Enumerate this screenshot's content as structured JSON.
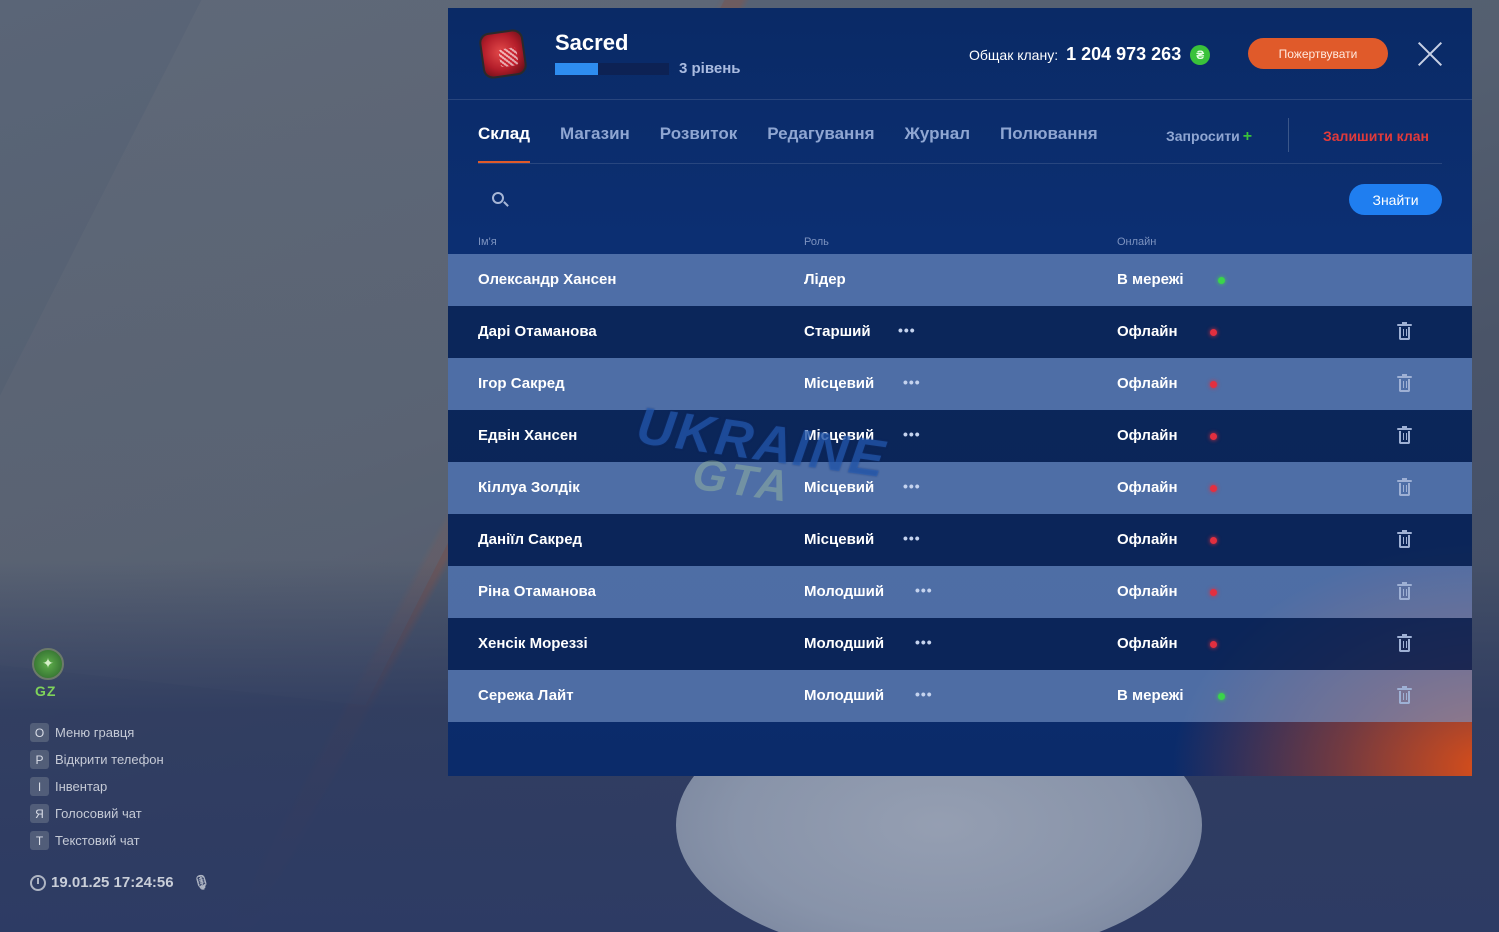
{
  "hud": {
    "badge_label": "GZ",
    "shortcuts": [
      {
        "key": "O",
        "label": "Меню гравця"
      },
      {
        "key": "P",
        "label": "Відкрити телефон"
      },
      {
        "key": "I",
        "label": "Інвентар"
      },
      {
        "key": "Я",
        "label": "Голосовий чат"
      },
      {
        "key": "T",
        "label": "Текстовий чат"
      }
    ],
    "datetime": "19.01.25 17:24:56"
  },
  "clan": {
    "name": "Sacred",
    "level_label": "3 рівень",
    "level_progress": 0.38,
    "treasury_label": "Общак клану:",
    "treasury_value": "1 204 973 263",
    "currency_symbol": "₴",
    "donate_label": "Пожертвувати"
  },
  "tabs": [
    {
      "label": "Склад",
      "active": true
    },
    {
      "label": "Магазин",
      "active": false
    },
    {
      "label": "Розвиток",
      "active": false
    },
    {
      "label": "Редагування",
      "active": false
    },
    {
      "label": "Журнал",
      "active": false
    },
    {
      "label": "Полювання",
      "active": false
    }
  ],
  "actions": {
    "invite_label": "Запросити",
    "leave_label": "Залишити клан"
  },
  "search": {
    "placeholder": "",
    "button_label": "Знайти"
  },
  "columns": {
    "name": "Ім'я",
    "role": "Роль",
    "online": "Онлайн"
  },
  "members": [
    {
      "name": "Олександр Хансен",
      "role": "Лідер",
      "status": "В мережі",
      "online": true,
      "has_menu": false,
      "deletable": false
    },
    {
      "name": "Дарі Отаманова",
      "role": "Старший",
      "status": "Офлайн",
      "online": false,
      "has_menu": true,
      "deletable": true
    },
    {
      "name": "Ігор Сакред",
      "role": "Місцевий",
      "status": "Офлайн",
      "online": false,
      "has_menu": true,
      "deletable": true
    },
    {
      "name": "Едвін Хансен",
      "role": "Місцевий",
      "status": "Офлайн",
      "online": false,
      "has_menu": true,
      "deletable": true
    },
    {
      "name": "Кіллуа Золдік",
      "role": "Місцевий",
      "status": "Офлайн",
      "online": false,
      "has_menu": true,
      "deletable": true
    },
    {
      "name": "Даніїл Сакред",
      "role": "Місцевий",
      "status": "Офлайн",
      "online": false,
      "has_menu": true,
      "deletable": true
    },
    {
      "name": "Ріна Отаманова",
      "role": "Молодший",
      "status": "Офлайн",
      "online": false,
      "has_menu": true,
      "deletable": true
    },
    {
      "name": "Хенсік Мореззі",
      "role": "Молодший",
      "status": "Офлайн",
      "online": false,
      "has_menu": true,
      "deletable": true
    },
    {
      "name": "Сережа Лайт",
      "role": "Молодший",
      "status": "В мережі",
      "online": true,
      "has_menu": true,
      "deletable": true
    }
  ],
  "watermark": {
    "line1": "UKRAINE",
    "line2": "GTA"
  },
  "colors": {
    "accent": "#e05a2a",
    "primary": "#1f7ef0",
    "online": "#3ad54a",
    "offline": "#e32f3f",
    "danger": "#e33a3a"
  }
}
